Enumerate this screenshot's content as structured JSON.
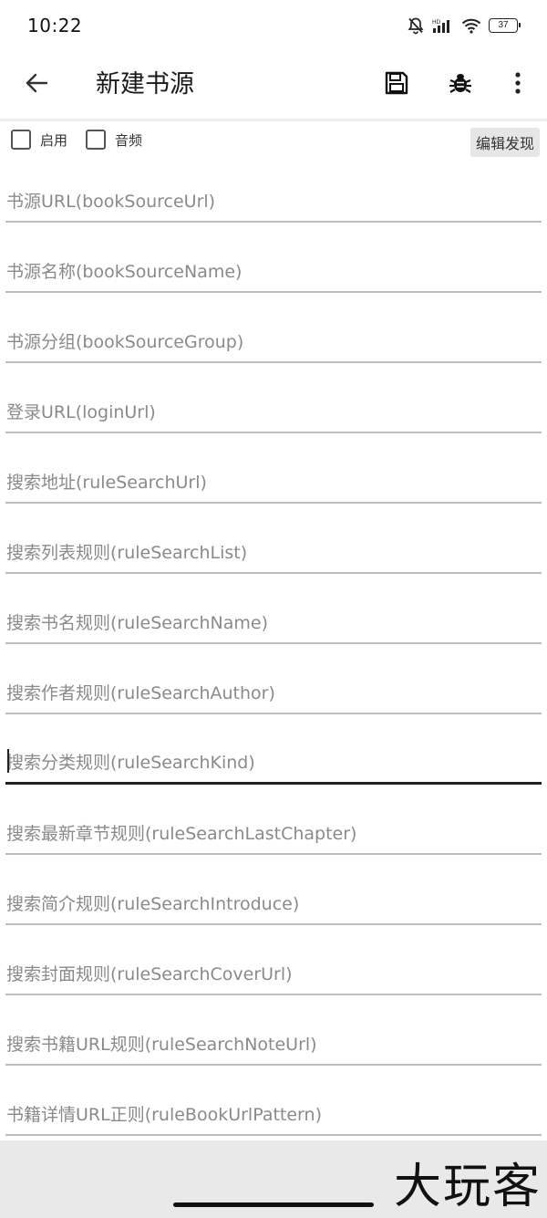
{
  "status_bar": {
    "time": "10:22",
    "battery_level": "37",
    "icons": [
      "mute-bell-icon",
      "signal-icon",
      "wifi-icon",
      "battery-icon"
    ]
  },
  "toolbar": {
    "title": "新建书源",
    "icons": [
      "back-arrow-icon",
      "save-icon",
      "bug-icon",
      "more-vert-icon"
    ]
  },
  "options": {
    "enable_label": "启用",
    "enable_checked": false,
    "audio_label": "音频",
    "audio_checked": false,
    "edit_discover_label": "编辑发现"
  },
  "fields": [
    {
      "placeholder": "书源URL(bookSourceUrl)",
      "value": ""
    },
    {
      "placeholder": "书源名称(bookSourceName)",
      "value": ""
    },
    {
      "placeholder": "书源分组(bookSourceGroup)",
      "value": ""
    },
    {
      "placeholder": "登录URL(loginUrl)",
      "value": ""
    },
    {
      "placeholder": "搜索地址(ruleSearchUrl)",
      "value": ""
    },
    {
      "placeholder": "搜索列表规则(ruleSearchList)",
      "value": ""
    },
    {
      "placeholder": "搜索书名规则(ruleSearchName)",
      "value": ""
    },
    {
      "placeholder": "搜索作者规则(ruleSearchAuthor)",
      "value": ""
    },
    {
      "placeholder": "搜索分类规则(ruleSearchKind)",
      "value": ""
    },
    {
      "placeholder": "搜索最新章节规则(ruleSearchLastChapter)",
      "value": ""
    },
    {
      "placeholder": "搜索简介规则(ruleSearchIntroduce)",
      "value": ""
    },
    {
      "placeholder": "搜索封面规则(ruleSearchCoverUrl)",
      "value": ""
    },
    {
      "placeholder": "搜索书籍URL规则(ruleSearchNoteUrl)",
      "value": ""
    },
    {
      "placeholder": "书籍详情URL正则(ruleBookUrlPattern)",
      "value": ""
    }
  ],
  "watermark": "大玩客"
}
